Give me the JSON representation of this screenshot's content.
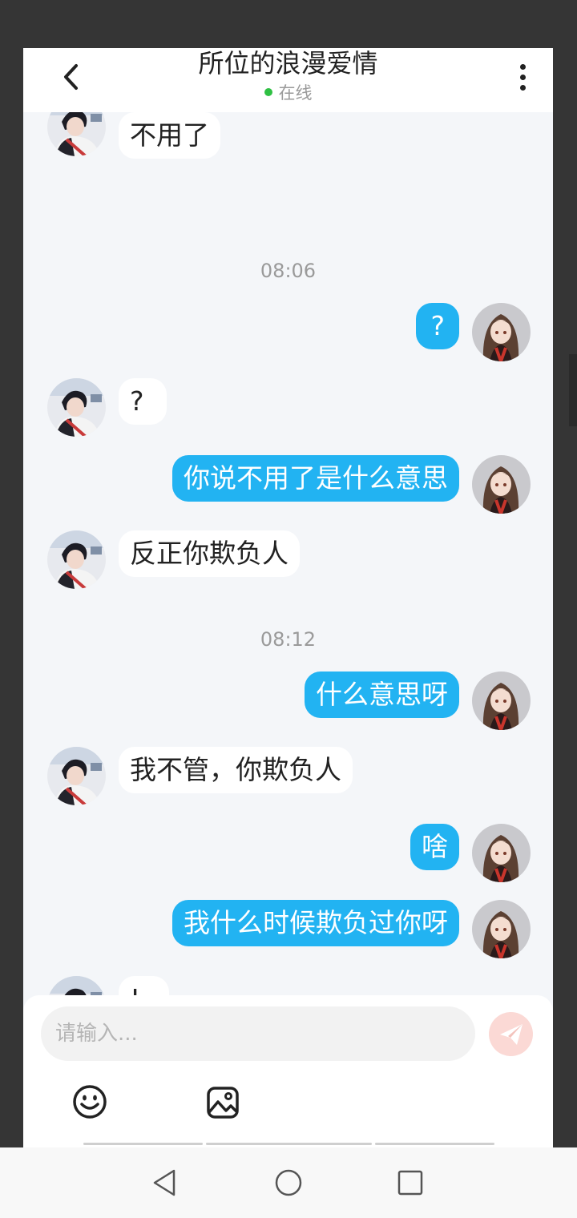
{
  "header": {
    "title": "所位的浪漫爱情",
    "status": "在线"
  },
  "colors": {
    "accent": "#22b3f2",
    "online": "#2fc043",
    "send_button": "#fbd9d5"
  },
  "messages": [
    {
      "side": "left",
      "text": "不用了"
    },
    {
      "type": "time",
      "text": "08:06"
    },
    {
      "side": "right",
      "text": "?"
    },
    {
      "side": "left",
      "text": "?"
    },
    {
      "side": "right",
      "text": "你说不用了是什么意思"
    },
    {
      "side": "left",
      "text": "反正你欺负人"
    },
    {
      "type": "time",
      "text": "08:12"
    },
    {
      "side": "right",
      "text": "什么意思呀"
    },
    {
      "side": "left",
      "text": "我不管，你欺负人"
    },
    {
      "side": "right",
      "text": "啥"
    },
    {
      "side": "right",
      "text": "我什么时候欺负过你呀"
    },
    {
      "side": "left",
      "text": "!"
    }
  ],
  "composer": {
    "placeholder": "请输入...",
    "emoji_icon": "smiley-icon",
    "image_icon": "image-icon",
    "send_icon": "paper-plane-icon"
  },
  "navbar": {
    "back_icon": "triangle-back-icon",
    "home_icon": "circle-home-icon",
    "recents_icon": "square-recents-icon"
  }
}
